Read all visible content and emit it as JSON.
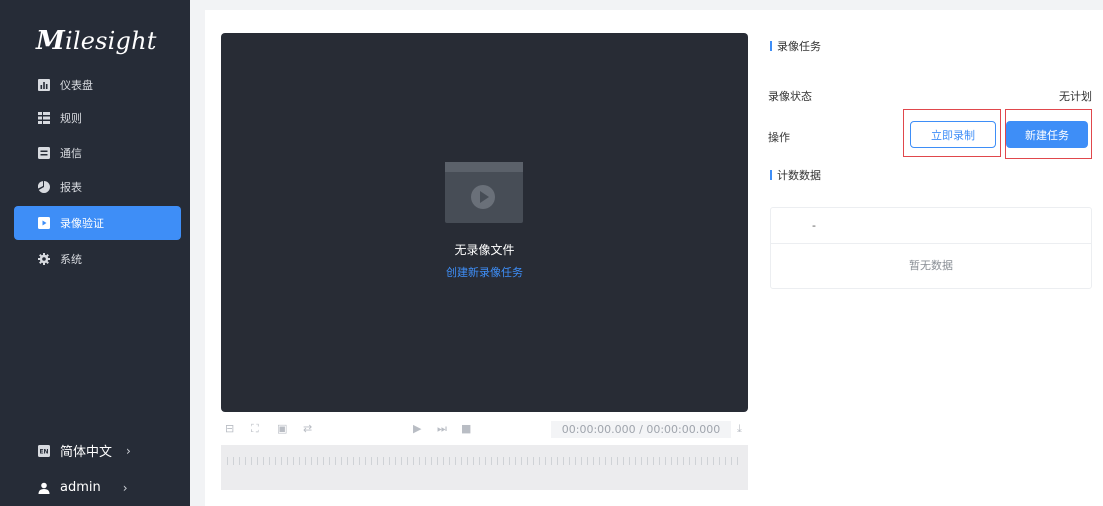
{
  "brand": {
    "logo_m": "M",
    "logo_rest": "ilesight"
  },
  "sidebar": {
    "items": [
      {
        "label": "仪表盘",
        "icon": "dashboard-icon"
      },
      {
        "label": "规则",
        "icon": "rules-icon"
      },
      {
        "label": "通信",
        "icon": "communication-icon"
      },
      {
        "label": "报表",
        "icon": "report-icon"
      },
      {
        "label": "录像验证",
        "icon": "video-verify-icon",
        "active": true
      },
      {
        "label": "系统",
        "icon": "gear-icon"
      }
    ],
    "language": "简体中文",
    "user": "admin"
  },
  "player": {
    "empty_title": "无录像文件",
    "create_link": "创建新录像任务",
    "timecode": "00:00:00.000 / 00:00:00.000"
  },
  "task": {
    "section_title": "录像任务",
    "status_label": "录像状态",
    "status_value": "无计划",
    "action_label": "操作",
    "record_now": "立即录制",
    "new_task": "新建任务"
  },
  "count": {
    "section_title": "计数数据",
    "column_header": "-",
    "empty_text": "暂无数据"
  },
  "colors": {
    "accent": "#3e8ef7",
    "sidebar_bg": "#262c37",
    "highlight": "#e0474c"
  }
}
